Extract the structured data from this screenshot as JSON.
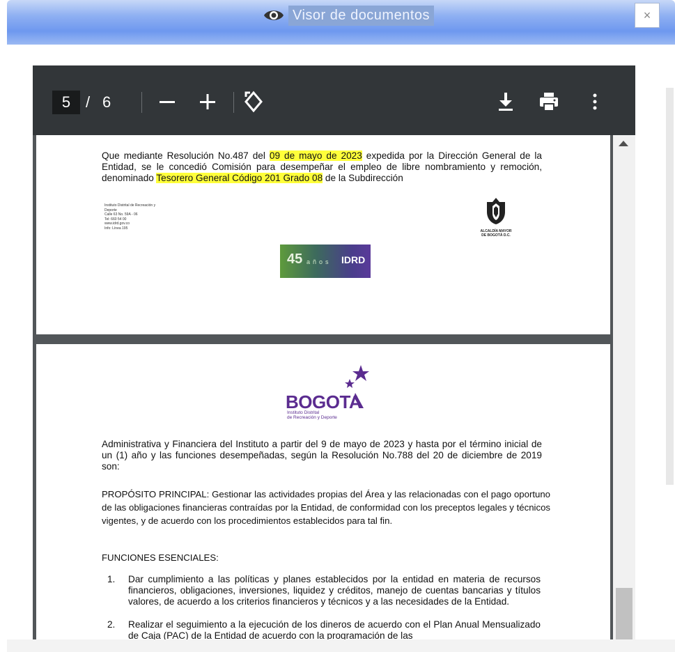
{
  "window": {
    "title": "Visor de documentos",
    "close_label": "×"
  },
  "toolbar": {
    "current_page": "5",
    "separator": "/",
    "total_pages": "6"
  },
  "page1": {
    "text_a": "Que mediante Resolución No.487 del ",
    "highlight_date": "09 de mayo de 2023",
    "text_b": " expedida por la Dirección General de la Entidad, se le concedió Comisión para desempeñar el empleo de libre nombramiento y remoción, denominado ",
    "highlight_cargo": "Tesorero General Código 201 Grado 08",
    "text_c": " de la Subdirección",
    "footer_info": [
      "Instituto Distrital de Recreación y",
      "Deporte",
      "Calle 63 No. 59A - 06",
      "Tel: 660 54 00",
      "www.idrd.gov.co",
      "Info: Línea 195"
    ],
    "badge_number": "45",
    "badge_anos": "años",
    "badge_name": "IDRD",
    "alcaldia": [
      "ALCALDÍA MAYOR",
      "DE BOGOTÁ D.C."
    ]
  },
  "page2": {
    "logo_word": "BOGOTA",
    "logo_sub": [
      "Instituto Distrital",
      "de Recreación y Deporte"
    ],
    "para1": "Administrativa y Financiera del Instituto a partir del 9 de mayo de 2023 y hasta por el término inicial de un (1) año y las funciones desempeñadas, según la Resolución No.788 del 20 de diciembre de 2019 son:",
    "proposito_label": "PROPÓSITO PRINCIPAL:",
    "proposito_text": " Gestionar las actividades propias del Área y las relacionadas con el pago oportuno de las obligaciones financieras contraídas por la Entidad, de conformidad con los preceptos legales y técnicos vigentes, y de acuerdo con los procedimientos establecidos para tal fin.",
    "funciones_label": "FUNCIONES ESENCIALES:",
    "funciones": [
      {
        "num": "1.",
        "text": "Dar cumplimiento a las políticas y planes establecidos por la entidad en materia de recursos financieros, obligaciones, inversiones, liquidez y créditos, manejo de cuentas bancarias y títulos valores, de acuerdo a los criterios financieros y técnicos y a las necesidades de la Entidad."
      },
      {
        "num": "2.",
        "text": "Realizar el seguimiento a la ejecución de los dineros de acuerdo con el Plan Anual Mensualizado de Caja (PAC) de la Entidad de acuerdo con la programación de las"
      }
    ]
  }
}
